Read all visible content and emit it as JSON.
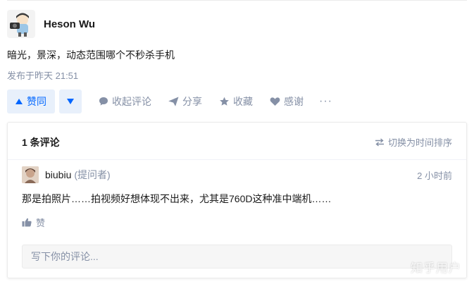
{
  "author": {
    "name": "Heson Wu",
    "avatar_icon": "cartoon-photographer-avatar"
  },
  "answer": {
    "text": "暗光，景深，动态范围哪个不秒杀手机",
    "time": "发布于昨天 21:51"
  },
  "actions": {
    "upvote_label": "赞同",
    "collapse_comments_label": "收起评论",
    "share_label": "分享",
    "favorite_label": "收藏",
    "thanks_label": "感谢",
    "more_label": "···"
  },
  "comments": {
    "count_label": "1 条评论",
    "switch_label": "切换为时间排序",
    "items": [
      {
        "name": "biubiu",
        "role": "(提问者)",
        "time": "2 小时前",
        "text": "那是拍照片……拍视频好想体现不出来，尤其是760D这种准中端机……",
        "like_label": "赞"
      }
    ],
    "input_placeholder": "写下你的评论..."
  },
  "watermark": "知乎用户",
  "colors": {
    "brand": "#0066ff",
    "brand_bg": "#e8f0fb",
    "muted": "#8590a6"
  }
}
